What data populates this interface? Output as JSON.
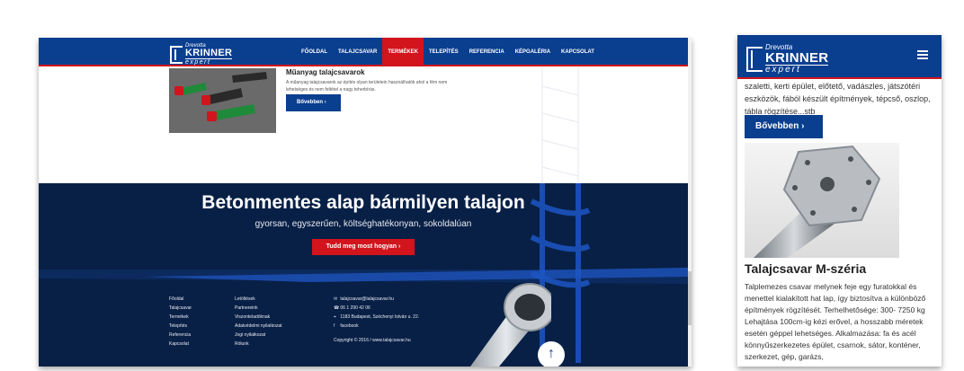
{
  "logo": {
    "line1": "Drevotta",
    "line2": "KRINNER",
    "line3": "expert"
  },
  "desktop": {
    "nav": [
      {
        "label": "FŐOLDAL",
        "active": false
      },
      {
        "label": "TALAJCSAVAR",
        "active": false
      },
      {
        "label": "TERMÉKEK",
        "active": true
      },
      {
        "label": "TELEPÍTÉS",
        "active": false
      },
      {
        "label": "REFERENCIA",
        "active": false
      },
      {
        "label": "KÉPGALÉRIA",
        "active": false
      },
      {
        "label": "KAPCSOLAT",
        "active": false
      }
    ],
    "product": {
      "title": "Műanyag talajcsavarok",
      "desc": "A műanyag talajcsavarok az építés olyan területein használhatók ahol a fém nem lehetséges és nem feltétel a nagy teherbírás.",
      "button": "Bővebben ›"
    },
    "hero": {
      "title": "Betonmentes alap bármilyen talajon",
      "subtitle": "gyorsan, egyszerűen, költséghatékonyan, sokoldalúan",
      "cta": "Tudd meg most hogyan ›"
    },
    "footer": {
      "col1": [
        "Főoldal",
        "Talajcsavar",
        "Termékek",
        "Telepítés",
        "Referencia",
        "Kapcsolat"
      ],
      "col2": [
        "Letöltések",
        "Partnereink",
        "Viszonteladóknak",
        "Adatvédelmi nyilatkozat",
        "Jogi nyilatkozat",
        "Rólunk"
      ],
      "contact": [
        {
          "icon": "mail-icon",
          "glyph": "✉",
          "text": "talajcsavar@talajcsavar.hu"
        },
        {
          "icon": "phone-icon",
          "glyph": "☎",
          "text": "06 1 290 42 06"
        },
        {
          "icon": "location-icon",
          "glyph": "⌖",
          "text": "1183 Budapest, Széchenyi István u. 22."
        },
        {
          "icon": "facebook-icon",
          "glyph": "f",
          "text": "facebook"
        }
      ],
      "copyright": "Copyright © 2016 / www.talajcsavar.hu"
    },
    "scroll_up": "↑"
  },
  "mobile": {
    "partial_text": "szaletti, kerti épület, előtető, vadászles, játszótéri eszközök, fából készült építmények, tépcső, oszlop, tábla rögzítése...stb",
    "button": "Bővebben ›",
    "title": "Talajcsavar M-széria",
    "desc": "Talplemezes csavar melynek feje egy furatokkal és menettel kialakított hat lap, így biztosítva a különböző építmények rögzítését. Terhelhetősége: 300- 7250 kg Lehajtása 100cm-ig kézi erővel, a hosszabb méretek esetén géppel lehetséges. Alkalmazása: fa és acél könnyűszerkezetes épület, csarnok, sátor, konténer, szerkezet, gép, garázs,"
  },
  "colors": {
    "brand_blue": "#0a3e8f",
    "accent_red": "#d2141d",
    "hero_navy": "#082046"
  }
}
